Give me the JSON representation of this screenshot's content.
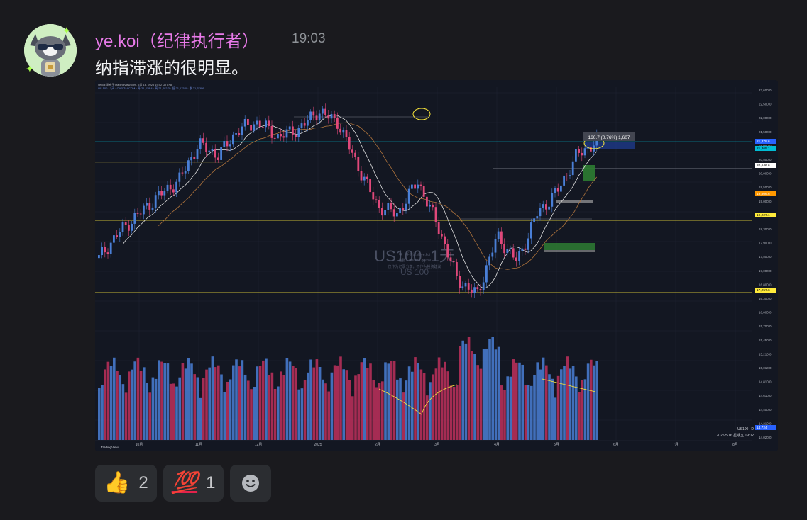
{
  "message": {
    "username": "ye.koi（纪律执行者）",
    "timestamp": "19:03",
    "text": "纳指滞涨的很明显。"
  },
  "chart": {
    "watermark_title": "US100, 1天",
    "watermark_sub": "US 100",
    "tooltip": "160.7 (0.76%) 1,607",
    "symbol_label": "US100 | D",
    "datetime_label": "2025/5/16 星期五 19:02",
    "brand": "TradingView",
    "price_ticks": [
      "22,600.0",
      "22,500.0",
      "22,000.0",
      "21,500.0",
      "21,000.0",
      "20,500.0",
      "20,000.0",
      "19,500.0",
      "19,000.0",
      "18,700.0",
      "18,300.0",
      "17,900.0",
      "17,500.0",
      "17,000.0",
      "16,800.0",
      "16,300.0",
      "16,000.0",
      "15,700.0",
      "15,450.0",
      "15,210.0",
      "15,010.0",
      "14,810.0",
      "14,610.0",
      "14,400.0",
      "14,210.0",
      "14,020.0"
    ],
    "price_labels": [
      {
        "text": "21,378.6",
        "color": "#2962ff"
      },
      {
        "text": "21,365.1",
        "color": "#00bcd4"
      },
      {
        "text": "20,646.6",
        "color": "#ffffff"
      },
      {
        "text": "19,806.6",
        "color": "#ff9800"
      },
      {
        "text": "19,227.1",
        "color": "#ffeb3b"
      },
      {
        "text": "17,257.6",
        "color": "#ffeb3b"
      },
      {
        "text": "14,724",
        "color": "#2962ff"
      }
    ],
    "x_ticks": [
      "10月",
      "11月",
      "12月",
      "2025",
      "2月",
      "3月",
      "4月",
      "5月",
      "6月",
      "7月",
      "8月"
    ]
  },
  "chart_data": {
    "type": "candlestick",
    "title": "US100, 1天",
    "x_labels": [
      "10月",
      "11月",
      "12月",
      "2025",
      "2月",
      "3月",
      "4月",
      "5月"
    ],
    "close_approx": [
      18200,
      18900,
      19400,
      19900,
      20300,
      21300,
      21000,
      21700,
      21900,
      21500,
      21700,
      22200,
      21900,
      20700,
      19600,
      19400,
      20300,
      19100,
      17600,
      17200,
      18800,
      18100,
      19400,
      20000,
      21000,
      21378.6
    ],
    "horizontal_levels": [
      21365.1,
      20646.6,
      19227.1,
      17257.6
    ],
    "series": [
      {
        "name": "US100 | D",
        "values": [
          18200,
          18900,
          19400,
          19900,
          20300,
          21300,
          21000,
          21700,
          21900,
          21500,
          21700,
          22200,
          21900,
          20700,
          19600,
          19400,
          20300,
          19100,
          17600,
          17200,
          18800,
          18100,
          19400,
          20000,
          21000,
          21378.6
        ]
      }
    ]
  },
  "reactions": [
    {
      "emoji": "👍",
      "count": "2",
      "icon": "thumbs-up-icon"
    },
    {
      "emoji": "💯",
      "count": "1",
      "icon": "hundred-points-icon"
    }
  ],
  "colors": {
    "username": "#e87ae8",
    "up_candle": "#4a7fd6",
    "down_candle": "#e0487a",
    "level_line": "#ffeb3b",
    "chart_bg": "#131722"
  }
}
